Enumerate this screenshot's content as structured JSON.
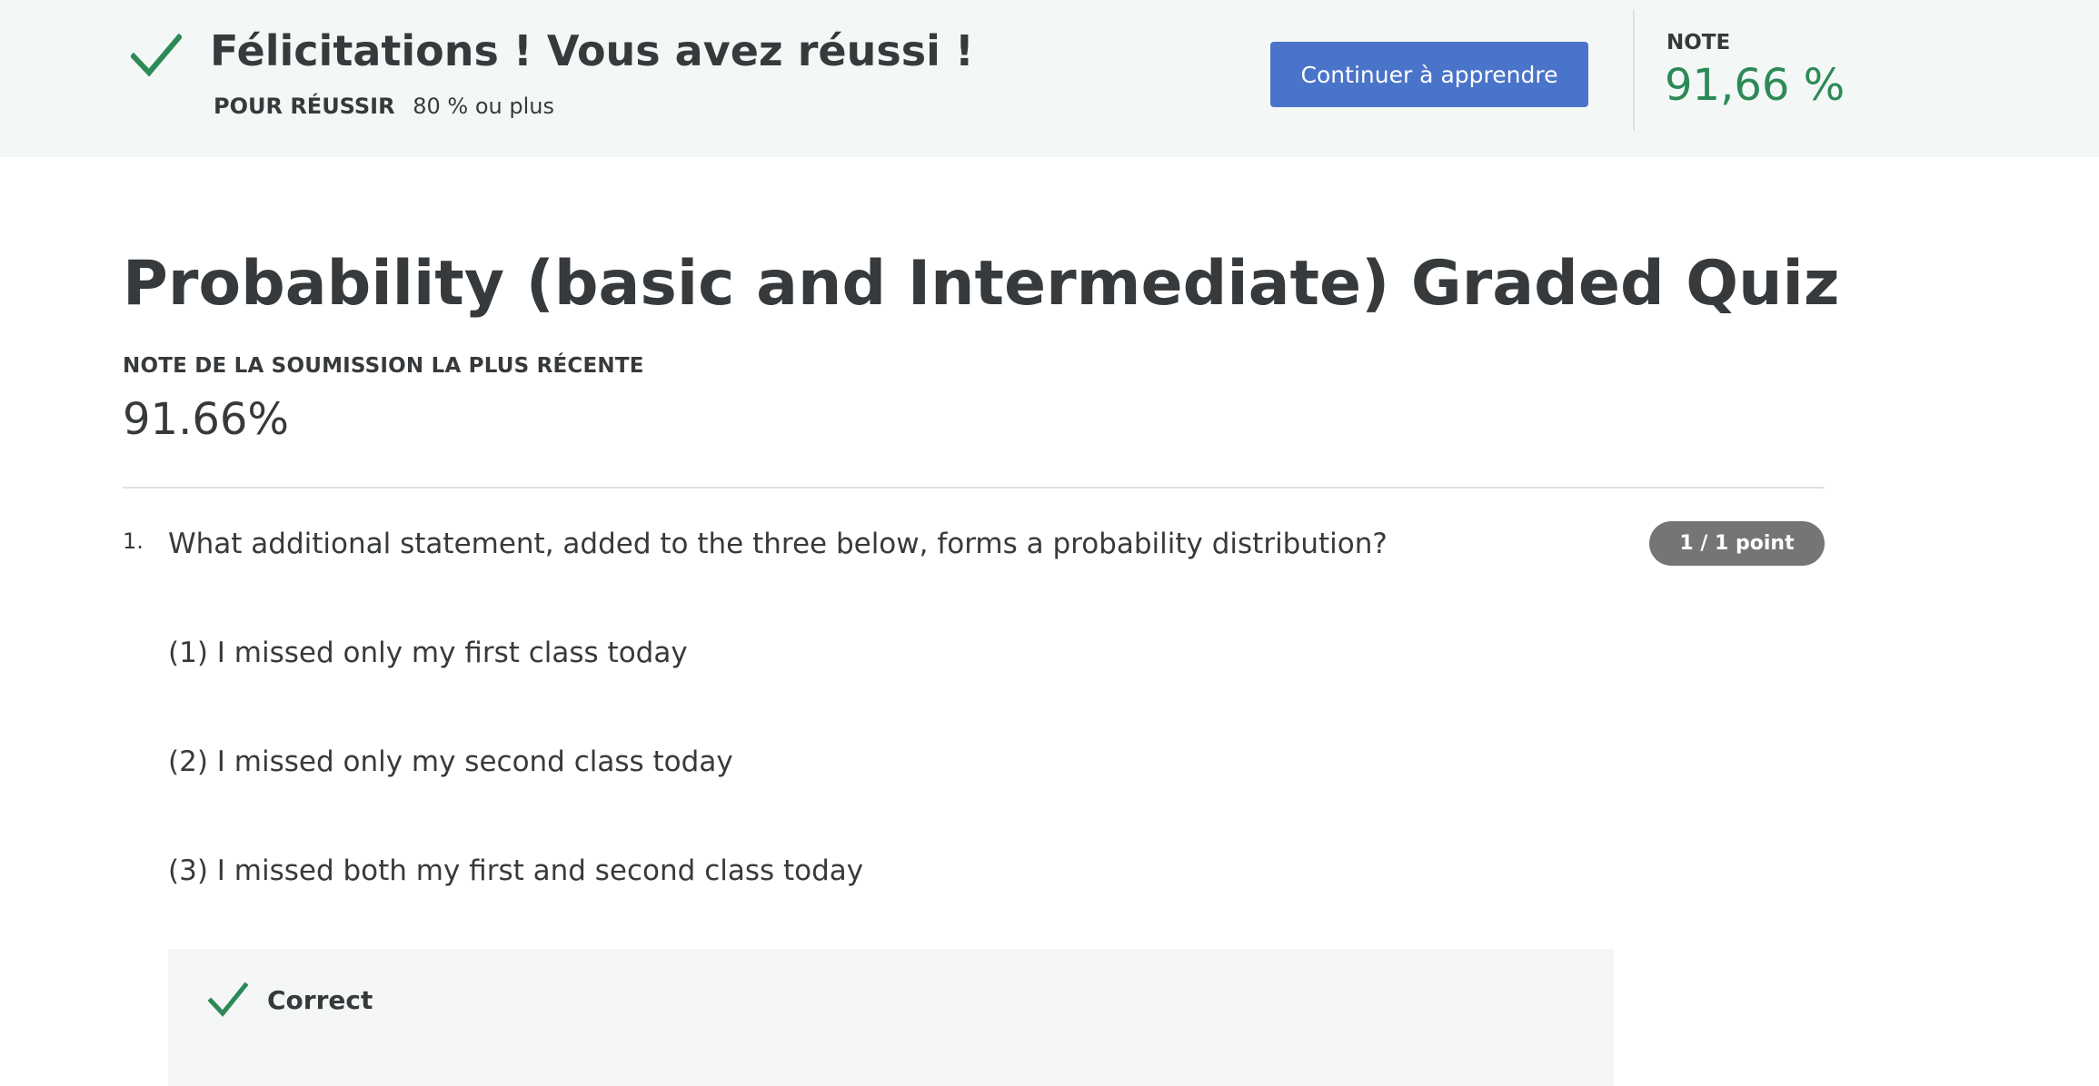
{
  "banner": {
    "title": "Félicitations ! Vous avez réussi !",
    "pass_label": "POUR RÉUSSIR",
    "pass_value": "80 % ou plus",
    "continue_label": "Continuer à apprendre",
    "grade_label": "NOTE",
    "grade_value": "91,66 %",
    "success_color": "#2d8a57",
    "button_color": "#4a74c9"
  },
  "quiz": {
    "title": "Probability (basic and Intermediate) Graded Quiz",
    "recent_label": "NOTE DE LA SOUMISSION LA PLUS RÉCENTE",
    "recent_value": "91.66%"
  },
  "questions": [
    {
      "number": "1.",
      "text": "What additional statement, added to the three below, forms a probability distribution?",
      "points": "1 / 1 point",
      "statements": [
        "(1) I missed only my first class today",
        "(2) I missed only my second class today",
        "(3) I missed both my first and second class today"
      ],
      "feedback": "Correct",
      "feedback_icon": "check-icon"
    }
  ]
}
